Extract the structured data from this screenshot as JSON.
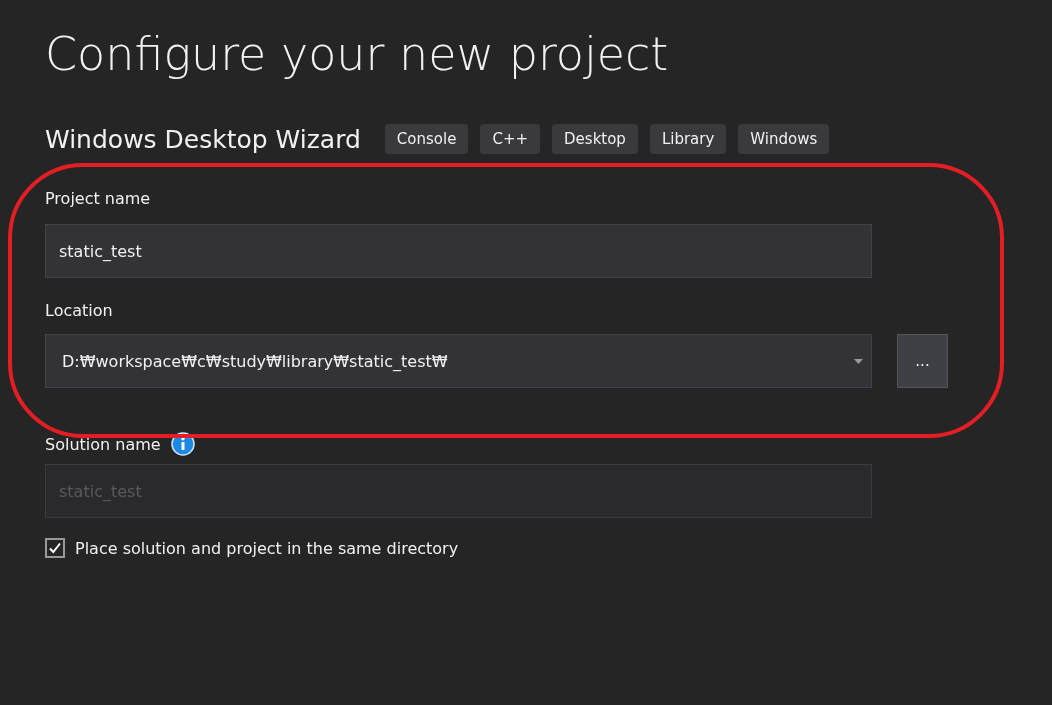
{
  "title": "Configure your new project",
  "template": {
    "name": "Windows Desktop Wizard",
    "tags": [
      "Console",
      "C++",
      "Desktop",
      "Library",
      "Windows"
    ]
  },
  "project_name": {
    "label": "Project name",
    "value": "static_test",
    "disabled": false
  },
  "location": {
    "label": "Location",
    "value": "D:₩workspace₩c₩study₩library₩static_test₩",
    "browse_label": "..."
  },
  "solution_name": {
    "label": "Solution name",
    "value": "static_test",
    "disabled": true
  },
  "same_directory": {
    "label": "Place solution and project in the same directory",
    "checked": true
  },
  "highlight": {
    "shown": true
  }
}
